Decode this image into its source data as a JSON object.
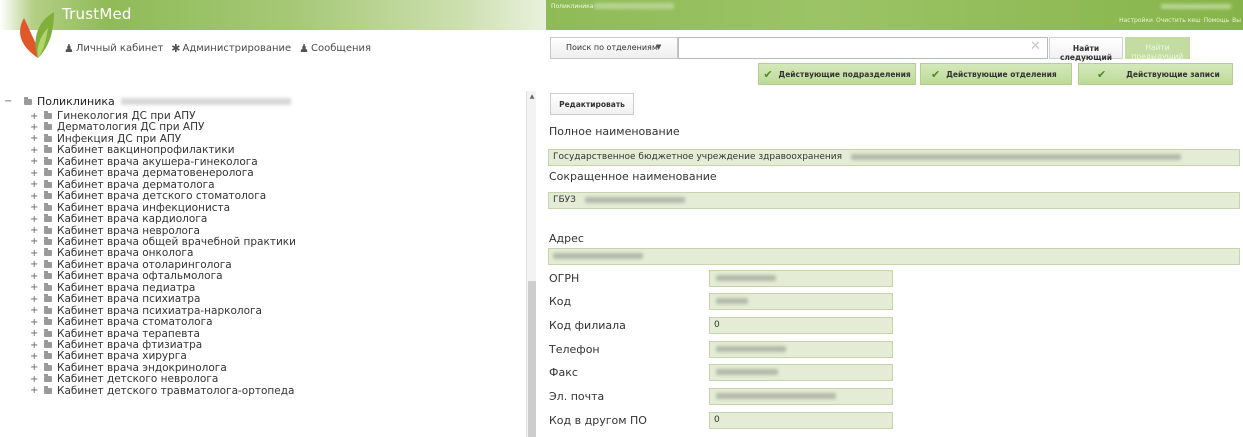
{
  "header": {
    "brand": "TrustMed",
    "nav": [
      {
        "icon": "user-icon",
        "label": "Личный кабинет"
      },
      {
        "icon": "tools-icon",
        "label": "Администрирование"
      },
      {
        "icon": "user-icon",
        "label": "Сообщения"
      }
    ],
    "clinic_label": "Поликлиника",
    "top_links": [
      "Настройки",
      "Очистить кеш",
      "Помощь",
      "Вы"
    ]
  },
  "search": {
    "mode": "Поиск по отделениям",
    "value": "",
    "next_label": "Найти следующий",
    "prev_label": "Найти предыдущий"
  },
  "tabs": [
    "Действующие подразделения",
    "Действующие отделения",
    "Действующие записи"
  ],
  "tree": {
    "root_label": "Поликлиника",
    "items": [
      "Гинекология ДС при АПУ",
      "Дерматология ДС при АПУ",
      "Инфекция ДС при АПУ",
      "Кабинет вакцинопрофилактики",
      "Кабинет врача акушера-гинеколога",
      "Кабинет врача дерматовенеролога",
      "Кабинет врача дерматолога",
      "Кабинет врача детского стоматолога",
      "Кабинет врача инфекциониста",
      "Кабинет врача кардиолога",
      "Кабинет врача невролога",
      "Кабинет врача общей врачебной практики",
      "Кабинет врача онколога",
      "Кабинет врача отоларинголога",
      "Кабинет врача офтальмолога",
      "Кабинет врача педиатра",
      "Кабинет врача психиатра",
      "Кабинет врача психиатра-нарколога",
      "Кабинет врача стоматолога",
      "Кабинет врача терапевта",
      "Кабинет врача фтизиатра",
      "Кабинет врача хирурга",
      "Кабинет врача эндокринолога",
      "Кабинет детского невролога",
      "Кабинет детского травматолога-ортопеда"
    ]
  },
  "detail": {
    "edit_label": "Редактировать",
    "full_name_label": "Полное наименование",
    "full_name_value": "Государственное бюджетное учреждение здравоохранения",
    "short_name_label": "Сокращенное наименование",
    "short_name_value": "ГБУЗ",
    "address_label": "Адрес",
    "fields": [
      {
        "label": "ОГРН",
        "value": ""
      },
      {
        "label": "Код",
        "value": ""
      },
      {
        "label": "Код филиала",
        "value": "0"
      },
      {
        "label": "Телефон",
        "value": ""
      },
      {
        "label": "Факс",
        "value": ""
      },
      {
        "label": "Эл. почта",
        "value": ""
      },
      {
        "label": "Код в другом ПО",
        "value": "0"
      }
    ]
  },
  "colors": {
    "brand_green": "#8fbb57",
    "field_bg": "#e4ecd5",
    "tab_bg": "#c7df a6"
  }
}
